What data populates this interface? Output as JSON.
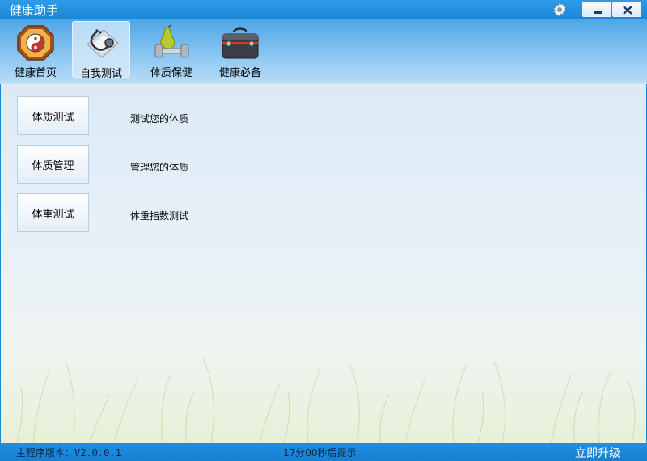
{
  "window": {
    "title": "健康助手"
  },
  "toolbar": {
    "items": [
      {
        "label": "健康首页",
        "icon": "taiji-icon",
        "active": false
      },
      {
        "label": "自我测试",
        "icon": "stethoscope-icon",
        "active": true
      },
      {
        "label": "体质保健",
        "icon": "dumbbell-pear-icon",
        "active": false
      },
      {
        "label": "健康必备",
        "icon": "first-aid-kit-icon",
        "active": false
      }
    ]
  },
  "main": {
    "rows": [
      {
        "button": "体质测试",
        "description": "测试您的体质"
      },
      {
        "button": "体质管理",
        "description": "管理您的体质"
      },
      {
        "button": "体重测试",
        "description": "体重指数测试"
      }
    ]
  },
  "status": {
    "version": "主程序版本：V2.0.0.1",
    "timer": "17分00秒后提示",
    "upgrade": "立即升级"
  },
  "colors": {
    "titlebar": "#1a86d6",
    "toolbar": "#7fc0ef",
    "statusbar": "#1780d0"
  }
}
